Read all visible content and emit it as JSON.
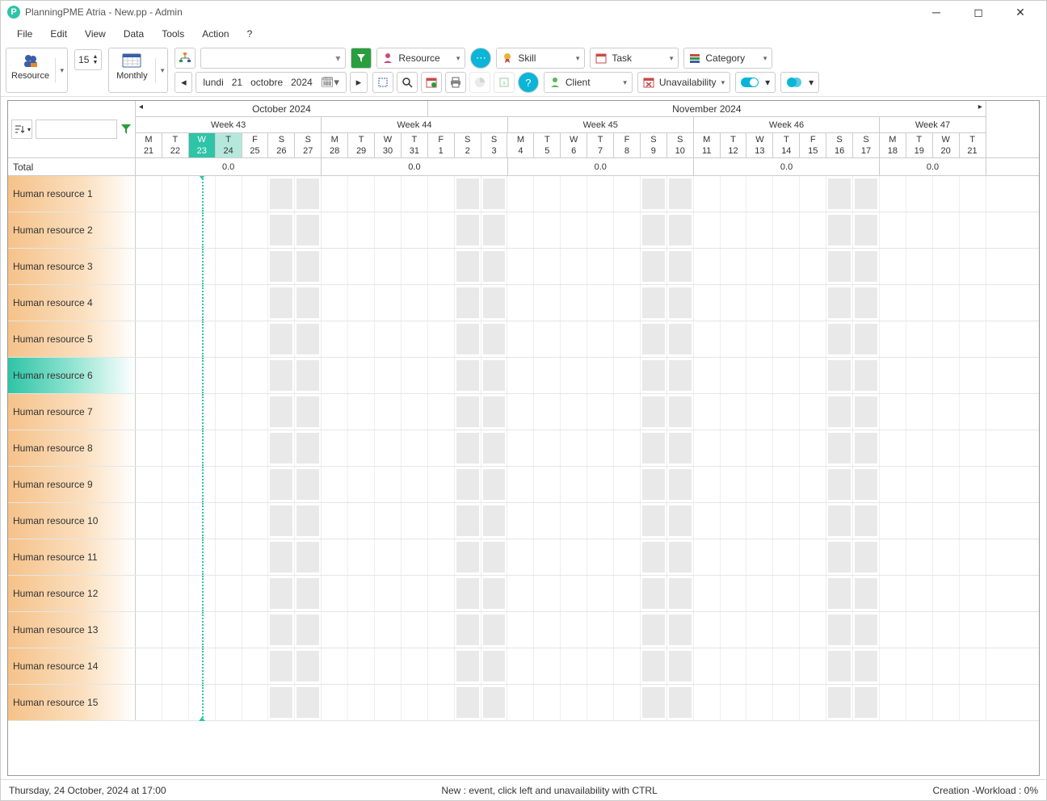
{
  "title": "PlanningPME Atria - New.pp - Admin",
  "menu": {
    "file": "File",
    "edit": "Edit",
    "view": "View",
    "data": "Data",
    "tools": "Tools",
    "action": "Action",
    "help": "?"
  },
  "toolbar": {
    "resource_btn": "Resource",
    "monthly_btn": "Monthly",
    "spinner_value": "15",
    "date_weekday": "lundi",
    "date_day": "21",
    "date_month": "octobre",
    "date_year": "2024"
  },
  "filters": {
    "resource": "Resource",
    "skill": "Skill",
    "task": "Task",
    "category": "Category",
    "client": "Client",
    "unavailability": "Unavailability"
  },
  "timeline": {
    "months": [
      {
        "label": "October 2024",
        "days": 11
      },
      {
        "label": "November 2024",
        "days": 21
      }
    ],
    "weeks": [
      {
        "label": "Week 43",
        "days": 7
      },
      {
        "label": "Week 44",
        "days": 7
      },
      {
        "label": "Week 45",
        "days": 7
      },
      {
        "label": "Week 46",
        "days": 7
      },
      {
        "label": "Week 47",
        "days": 4
      }
    ],
    "days": [
      {
        "dow": "M",
        "num": "21",
        "weekend": false,
        "today": false
      },
      {
        "dow": "T",
        "num": "22",
        "weekend": false,
        "today": false
      },
      {
        "dow": "W",
        "num": "23",
        "weekend": false,
        "today": true
      },
      {
        "dow": "T",
        "num": "24",
        "weekend": false,
        "today": false,
        "tomorrow": true
      },
      {
        "dow": "F",
        "num": "25",
        "weekend": false,
        "today": false
      },
      {
        "dow": "S",
        "num": "26",
        "weekend": true,
        "today": false
      },
      {
        "dow": "S",
        "num": "27",
        "weekend": true,
        "today": false
      },
      {
        "dow": "M",
        "num": "28",
        "weekend": false,
        "today": false
      },
      {
        "dow": "T",
        "num": "29",
        "weekend": false,
        "today": false
      },
      {
        "dow": "W",
        "num": "30",
        "weekend": false,
        "today": false
      },
      {
        "dow": "T",
        "num": "31",
        "weekend": false,
        "today": false
      },
      {
        "dow": "F",
        "num": "1",
        "weekend": false,
        "today": false
      },
      {
        "dow": "S",
        "num": "2",
        "weekend": true,
        "today": false
      },
      {
        "dow": "S",
        "num": "3",
        "weekend": true,
        "today": false
      },
      {
        "dow": "M",
        "num": "4",
        "weekend": false,
        "today": false
      },
      {
        "dow": "T",
        "num": "5",
        "weekend": false,
        "today": false
      },
      {
        "dow": "W",
        "num": "6",
        "weekend": false,
        "today": false
      },
      {
        "dow": "T",
        "num": "7",
        "weekend": false,
        "today": false
      },
      {
        "dow": "F",
        "num": "8",
        "weekend": false,
        "today": false
      },
      {
        "dow": "S",
        "num": "9",
        "weekend": true,
        "today": false
      },
      {
        "dow": "S",
        "num": "10",
        "weekend": true,
        "today": false
      },
      {
        "dow": "M",
        "num": "11",
        "weekend": false,
        "today": false
      },
      {
        "dow": "T",
        "num": "12",
        "weekend": false,
        "today": false
      },
      {
        "dow": "W",
        "num": "13",
        "weekend": false,
        "today": false
      },
      {
        "dow": "T",
        "num": "14",
        "weekend": false,
        "today": false
      },
      {
        "dow": "F",
        "num": "15",
        "weekend": false,
        "today": false
      },
      {
        "dow": "S",
        "num": "16",
        "weekend": true,
        "today": false
      },
      {
        "dow": "S",
        "num": "17",
        "weekend": true,
        "today": false
      },
      {
        "dow": "M",
        "num": "18",
        "weekend": false,
        "today": false
      },
      {
        "dow": "T",
        "num": "19",
        "weekend": false,
        "today": false
      },
      {
        "dow": "W",
        "num": "20",
        "weekend": false,
        "today": false
      },
      {
        "dow": "T",
        "num": "21",
        "weekend": false,
        "today": false
      }
    ],
    "total_label": "Total",
    "totals": [
      "0.0",
      "0.0",
      "0.0",
      "0.0",
      "0.0"
    ]
  },
  "resources": [
    {
      "name": "Human resource 1",
      "highlight": false
    },
    {
      "name": "Human resource 2",
      "highlight": false
    },
    {
      "name": "Human resource 3",
      "highlight": false
    },
    {
      "name": "Human resource 4",
      "highlight": false
    },
    {
      "name": "Human resource 5",
      "highlight": false
    },
    {
      "name": "Human resource 6",
      "highlight": true
    },
    {
      "name": "Human resource 7",
      "highlight": false
    },
    {
      "name": "Human resource 8",
      "highlight": false
    },
    {
      "name": "Human resource 9",
      "highlight": false
    },
    {
      "name": "Human resource 10",
      "highlight": false
    },
    {
      "name": "Human resource 11",
      "highlight": false
    },
    {
      "name": "Human resource 12",
      "highlight": false
    },
    {
      "name": "Human resource 13",
      "highlight": false
    },
    {
      "name": "Human resource 14",
      "highlight": false
    },
    {
      "name": "Human resource 15",
      "highlight": false
    }
  ],
  "status": {
    "left": "Thursday, 24 October, 2024 at 17:00",
    "center": "New : event, click left and unavailability with CTRL",
    "right": "Creation -Workload : 0%"
  }
}
